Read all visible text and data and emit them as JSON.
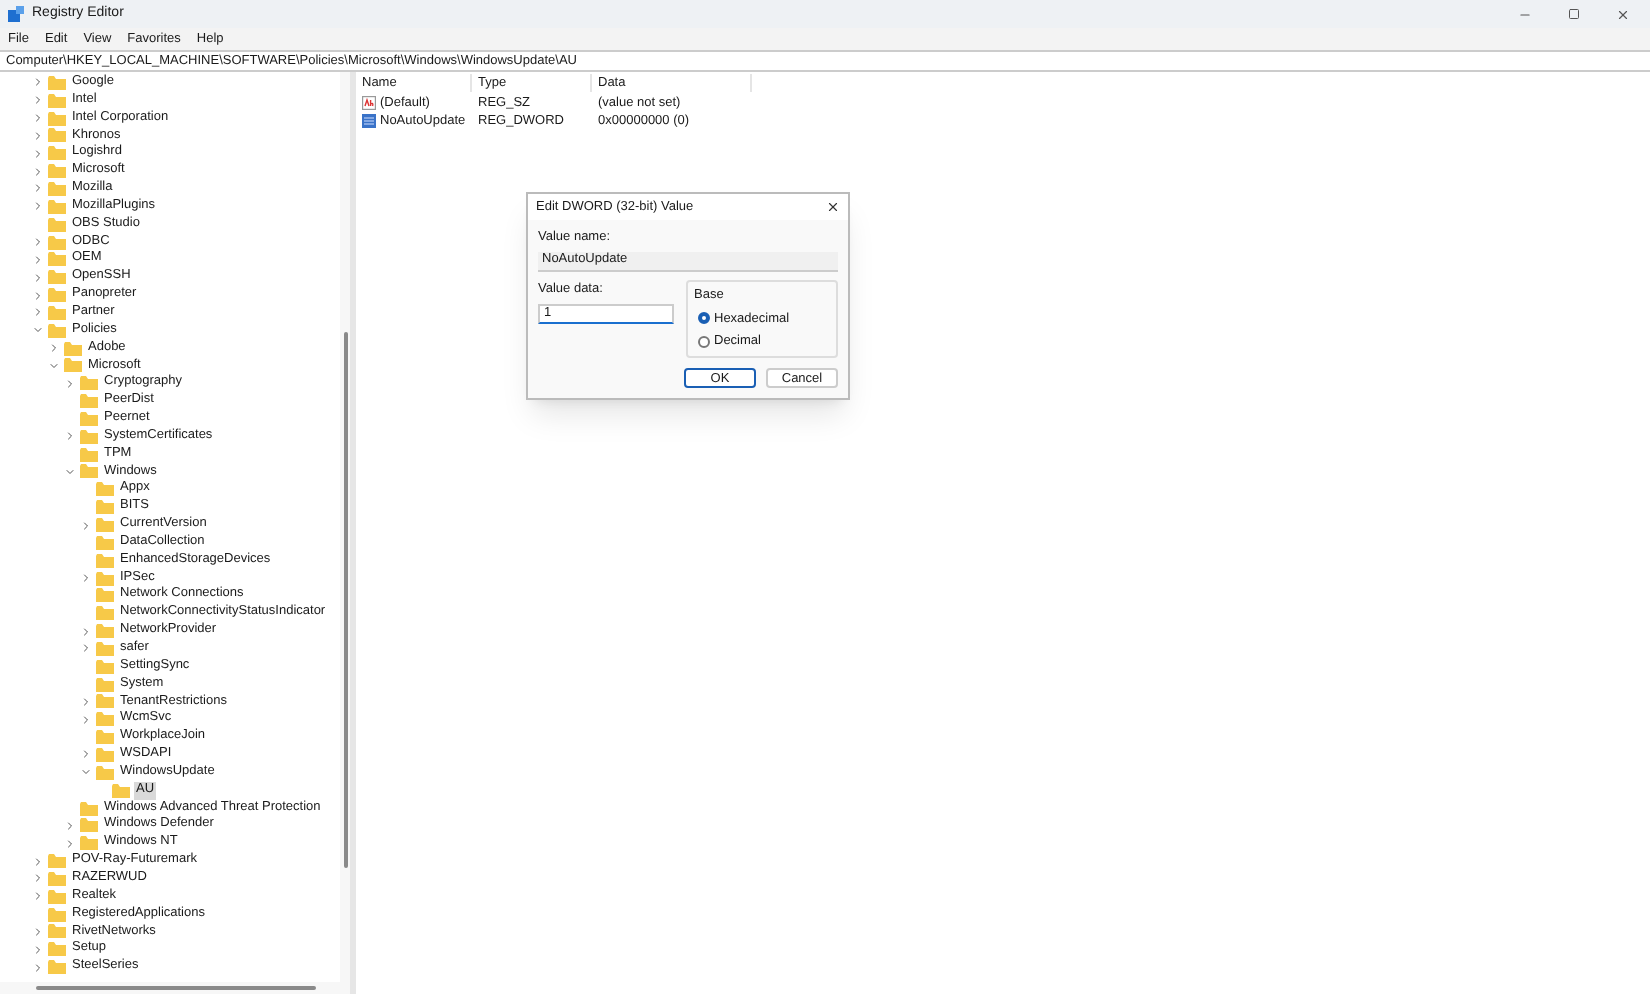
{
  "window": {
    "title": "Registry Editor"
  },
  "menu": [
    "File",
    "Edit",
    "View",
    "Favorites",
    "Help"
  ],
  "address": "Computer\\HKEY_LOCAL_MACHINE\\SOFTWARE\\Policies\\Microsoft\\Windows\\WindowsUpdate\\AU",
  "tree": [
    {
      "label": "Google",
      "expanded": false,
      "selected": false
    },
    {
      "label": "Intel",
      "expanded": false,
      "selected": false
    },
    {
      "label": "Intel Corporation",
      "expanded": false,
      "selected": false
    },
    {
      "label": "Khronos",
      "expanded": false,
      "selected": false
    },
    {
      "label": "Logishrd",
      "expanded": false,
      "selected": false
    },
    {
      "label": "Microsoft",
      "expanded": false,
      "selected": false
    },
    {
      "label": "Mozilla",
      "expanded": false,
      "selected": false
    },
    {
      "label": "MozillaPlugins",
      "expanded": false,
      "selected": false
    },
    {
      "label": "OBS Studio",
      "selected": false
    },
    {
      "label": "ODBC",
      "expanded": false,
      "selected": false
    },
    {
      "label": "OEM",
      "expanded": false,
      "selected": false
    },
    {
      "label": "OpenSSH",
      "expanded": false,
      "selected": false
    },
    {
      "label": "Panopreter",
      "expanded": false,
      "selected": false
    },
    {
      "label": "Partner",
      "expanded": false,
      "selected": false
    },
    {
      "label": "Policies",
      "expanded": true,
      "selected": false,
      "children": [
        {
          "label": "Adobe",
          "expanded": false,
          "selected": false
        },
        {
          "label": "Microsoft",
          "expanded": true,
          "selected": false,
          "children": [
            {
              "label": "Cryptography",
              "expanded": false,
              "selected": false
            },
            {
              "label": "PeerDist",
              "selected": false
            },
            {
              "label": "Peernet",
              "selected": false
            },
            {
              "label": "SystemCertificates",
              "expanded": false,
              "selected": false
            },
            {
              "label": "TPM",
              "selected": false
            },
            {
              "label": "Windows",
              "expanded": true,
              "selected": false,
              "children": [
                {
                  "label": "Appx",
                  "selected": false
                },
                {
                  "label": "BITS",
                  "selected": false
                },
                {
                  "label": "CurrentVersion",
                  "expanded": false,
                  "selected": false
                },
                {
                  "label": "DataCollection",
                  "selected": false
                },
                {
                  "label": "EnhancedStorageDevices",
                  "selected": false
                },
                {
                  "label": "IPSec",
                  "expanded": false,
                  "selected": false
                },
                {
                  "label": "Network Connections",
                  "selected": false
                },
                {
                  "label": "NetworkConnectivityStatusIndicator",
                  "selected": false
                },
                {
                  "label": "NetworkProvider",
                  "expanded": false,
                  "selected": false
                },
                {
                  "label": "safer",
                  "expanded": false,
                  "selected": false
                },
                {
                  "label": "SettingSync",
                  "selected": false
                },
                {
                  "label": "System",
                  "selected": false
                },
                {
                  "label": "TenantRestrictions",
                  "expanded": false,
                  "selected": false
                },
                {
                  "label": "WcmSvc",
                  "expanded": false,
                  "selected": false
                },
                {
                  "label": "WorkplaceJoin",
                  "selected": false
                },
                {
                  "label": "WSDAPI",
                  "expanded": false,
                  "selected": false
                },
                {
                  "label": "WindowsUpdate",
                  "expanded": true,
                  "selected": false,
                  "children": [
                    {
                      "label": "AU",
                      "selected": true
                    }
                  ]
                }
              ]
            },
            {
              "label": "Windows Advanced Threat Protection",
              "selected": false
            },
            {
              "label": "Windows Defender",
              "expanded": false,
              "selected": false
            },
            {
              "label": "Windows NT",
              "expanded": false,
              "selected": false
            }
          ]
        }
      ]
    },
    {
      "label": "POV-Ray-Futuremark",
      "expanded": false,
      "selected": false
    },
    {
      "label": "RAZERWUD",
      "expanded": false,
      "selected": false
    },
    {
      "label": "Realtek",
      "expanded": false,
      "selected": false
    },
    {
      "label": "RegisteredApplications",
      "selected": false
    },
    {
      "label": "RivetNetworks",
      "expanded": false,
      "selected": false
    },
    {
      "label": "Setup",
      "expanded": false,
      "selected": false
    },
    {
      "label": "SteelSeries",
      "expanded": false,
      "selected": false
    }
  ],
  "values": {
    "columns": [
      "Name",
      "Type",
      "Data"
    ],
    "rows": [
      {
        "kind": "string",
        "name": "(Default)",
        "type": "REG_SZ",
        "data": "(value not set)"
      },
      {
        "kind": "dword",
        "name": "NoAutoUpdate",
        "type": "REG_DWORD",
        "data": "0x00000000 (0)"
      }
    ]
  },
  "dialog": {
    "title": "Edit DWORD (32-bit) Value",
    "value_name_label": "Value name:",
    "value_name": "NoAutoUpdate",
    "value_data_label": "Value data:",
    "value_data": "1",
    "base_label": "Base",
    "base_options": [
      {
        "label": "Hexadecimal",
        "selected": true
      },
      {
        "label": "Decimal",
        "selected": false
      }
    ],
    "buttons": [
      {
        "label": "OK",
        "kind": "default"
      },
      {
        "label": "Cancel",
        "kind": "normal"
      }
    ]
  }
}
